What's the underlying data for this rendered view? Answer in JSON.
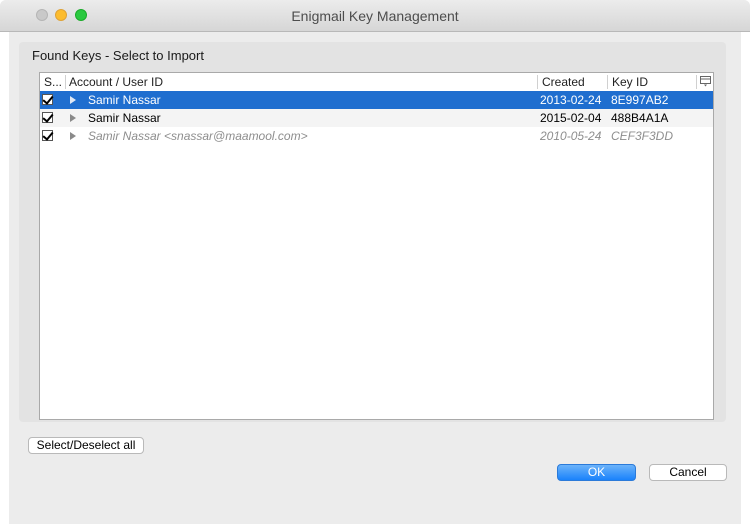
{
  "window": {
    "title": "Enigmail Key Management"
  },
  "panel": {
    "heading": "Found Keys - Select to Import"
  },
  "table": {
    "columns": {
      "select": "S...",
      "account": "Account / User ID",
      "created": "Created",
      "key_id": "Key ID"
    },
    "rows": [
      {
        "checked": true,
        "account": "Samir Nassar",
        "created": "2013-02-24",
        "key_id": "8E997AB2",
        "selected": true
      },
      {
        "checked": true,
        "account": "Samir Nassar",
        "created": "2015-02-04",
        "key_id": "488B4A1A",
        "selected": false
      },
      {
        "checked": true,
        "account": "Samir Nassar <snassar@maamool.com>",
        "created": "2010-05-24",
        "key_id": "CEF3F3DD",
        "selected": false
      }
    ]
  },
  "buttons": {
    "select_all": "Select/Deselect all",
    "ok": "OK",
    "cancel": "Cancel"
  },
  "colors": {
    "selection": "#1f6ecf",
    "primary_button": "#1a82fb"
  }
}
